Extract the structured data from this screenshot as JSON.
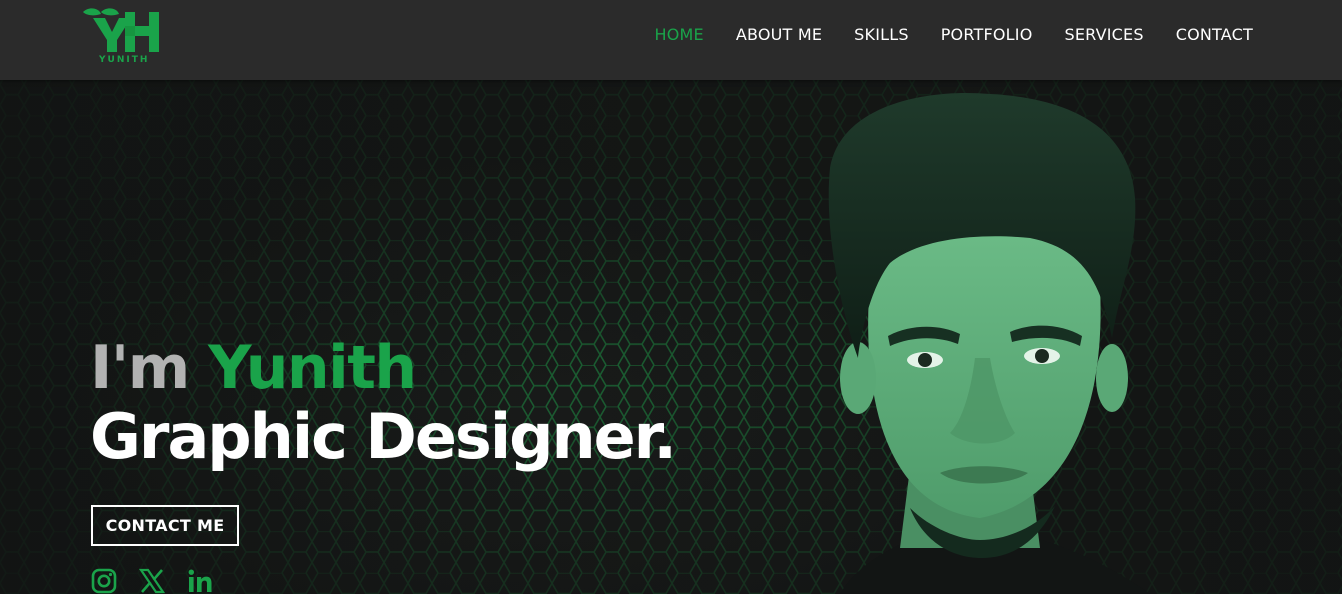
{
  "brand": {
    "monogram": "YH",
    "name": "YUNITH",
    "accent_color": "#1aa34a"
  },
  "nav": {
    "items": [
      {
        "label": "HOME",
        "active": true
      },
      {
        "label": "ABOUT ME",
        "active": false
      },
      {
        "label": "SKILLS",
        "active": false
      },
      {
        "label": "PORTFOLIO",
        "active": false
      },
      {
        "label": "SERVICES",
        "active": false
      },
      {
        "label": "CONTACT",
        "active": false
      }
    ]
  },
  "hero": {
    "intro_prefix": "I'm ",
    "name": "Yunith",
    "role": "Graphic Designer.",
    "cta_label": "CONTACT ME",
    "background_pattern": "hexagon-grid",
    "portrait": "profile-photo"
  },
  "socials": [
    {
      "icon": "instagram-icon"
    },
    {
      "icon": "x-icon"
    },
    {
      "icon": "linkedin-icon"
    }
  ],
  "colors": {
    "header_bg": "#2b2b2b",
    "hero_bg": "#1c1e1d",
    "accent": "#1aa34a",
    "text": "#ffffff",
    "muted_text": "#b2b2b2"
  }
}
